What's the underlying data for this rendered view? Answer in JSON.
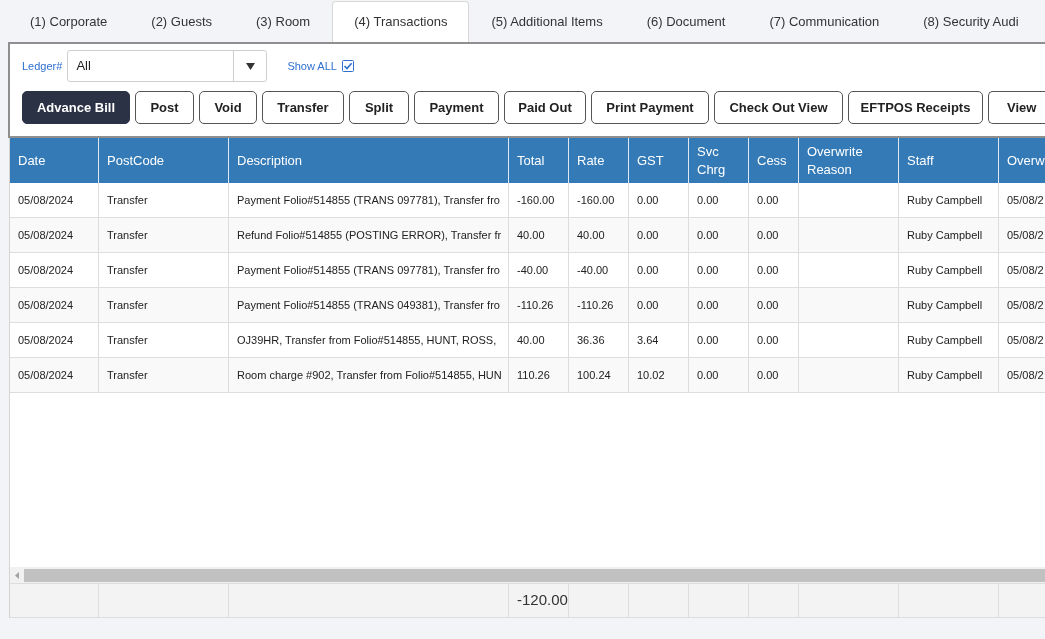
{
  "tabs": [
    {
      "label": "(1) Corporate",
      "selected": false
    },
    {
      "label": "(2) Guests",
      "selected": false
    },
    {
      "label": "(3) Room",
      "selected": false
    },
    {
      "label": "(4) Transactions",
      "selected": true
    },
    {
      "label": "(5) Additional Items",
      "selected": false
    },
    {
      "label": "(6) Document",
      "selected": false
    },
    {
      "label": "(7) Communication",
      "selected": false
    },
    {
      "label": "(8) Security Audi",
      "selected": false
    }
  ],
  "filters": {
    "ledger_label": "Ledger#",
    "ledger_select": {
      "value": "All"
    },
    "show_all": {
      "label": "Show ALL",
      "checked": true
    }
  },
  "buttons": [
    {
      "label": "Advance Bill",
      "kind": "primary"
    },
    {
      "label": "Post",
      "kind": "outline"
    },
    {
      "label": "Void",
      "kind": "outline"
    },
    {
      "label": "Transfer",
      "kind": "outline"
    },
    {
      "label": "Split",
      "kind": "outline"
    },
    {
      "label": "Payment",
      "kind": "outline"
    },
    {
      "label": "Paid Out",
      "kind": "outline"
    },
    {
      "label": "Print Payment",
      "kind": "outline"
    },
    {
      "label": "Check Out View",
      "kind": "outline"
    },
    {
      "label": "EFTPOS Receipts",
      "kind": "outline"
    },
    {
      "label": "View",
      "kind": "outline"
    }
  ],
  "table": {
    "columns": [
      "Date",
      "PostCode",
      "Description",
      "Total",
      "Rate",
      "GST",
      "Svc Chrg",
      "Cess",
      "Overwrite Reason",
      "Staff",
      "Overw"
    ],
    "rows": [
      {
        "date": "05/08/2024",
        "postcode": "Transfer",
        "description": "Payment Folio#514855 (TRANS 097781), Transfer fro",
        "total": "-160.00",
        "rate": "-160.00",
        "gst": "0.00",
        "svc_chrg": "0.00",
        "cess": "0.00",
        "staff": "Ruby Campbell",
        "column_11": "05/08/2"
      },
      {
        "date": "05/08/2024",
        "postcode": "Transfer",
        "description": "Refund Folio#514855 (POSTING ERROR), Transfer fr",
        "total": "40.00",
        "rate": "40.00",
        "gst": "0.00",
        "svc_chrg": "0.00",
        "cess": "0.00",
        "staff": "Ruby Campbell",
        "column_11": "05/08/2"
      },
      {
        "date": "05/08/2024",
        "postcode": "Transfer",
        "description": "Payment Folio#514855 (TRANS 097781), Transfer fro",
        "total": "-40.00",
        "rate": "-40.00",
        "gst": "0.00",
        "svc_chrg": "0.00",
        "cess": "0.00",
        "staff": "Ruby Campbell",
        "column_11": "05/08/2"
      },
      {
        "date": "05/08/2024",
        "postcode": "Transfer",
        "description": "Payment Folio#514855 (TRANS 049381), Transfer fro",
        "total": "-110.26",
        "rate": "-110.26",
        "gst": "0.00",
        "svc_chrg": "0.00",
        "cess": "0.00",
        "staff": "Ruby Campbell",
        "column_11": "05/08/2"
      },
      {
        "date": "05/08/2024",
        "postcode": "Transfer",
        "description": "OJ39HR, Transfer from Folio#514855, HUNT, ROSS,",
        "total": "40.00",
        "rate": "36.36",
        "gst": "3.64",
        "svc_chrg": "0.00",
        "cess": "0.00",
        "staff": "Ruby Campbell",
        "column_11": "05/08/2"
      },
      {
        "date": "05/08/2024",
        "postcode": "Transfer",
        "description": "Room charge #902, Transfer from Folio#514855, HUN",
        "total": "110.26",
        "rate": "100.24",
        "gst": "10.02",
        "svc_chrg": "0.00",
        "cess": "0.00",
        "staff": "Ruby Campbell",
        "column_11": "05/08/2"
      }
    ],
    "footer_total": "-120.00"
  }
}
